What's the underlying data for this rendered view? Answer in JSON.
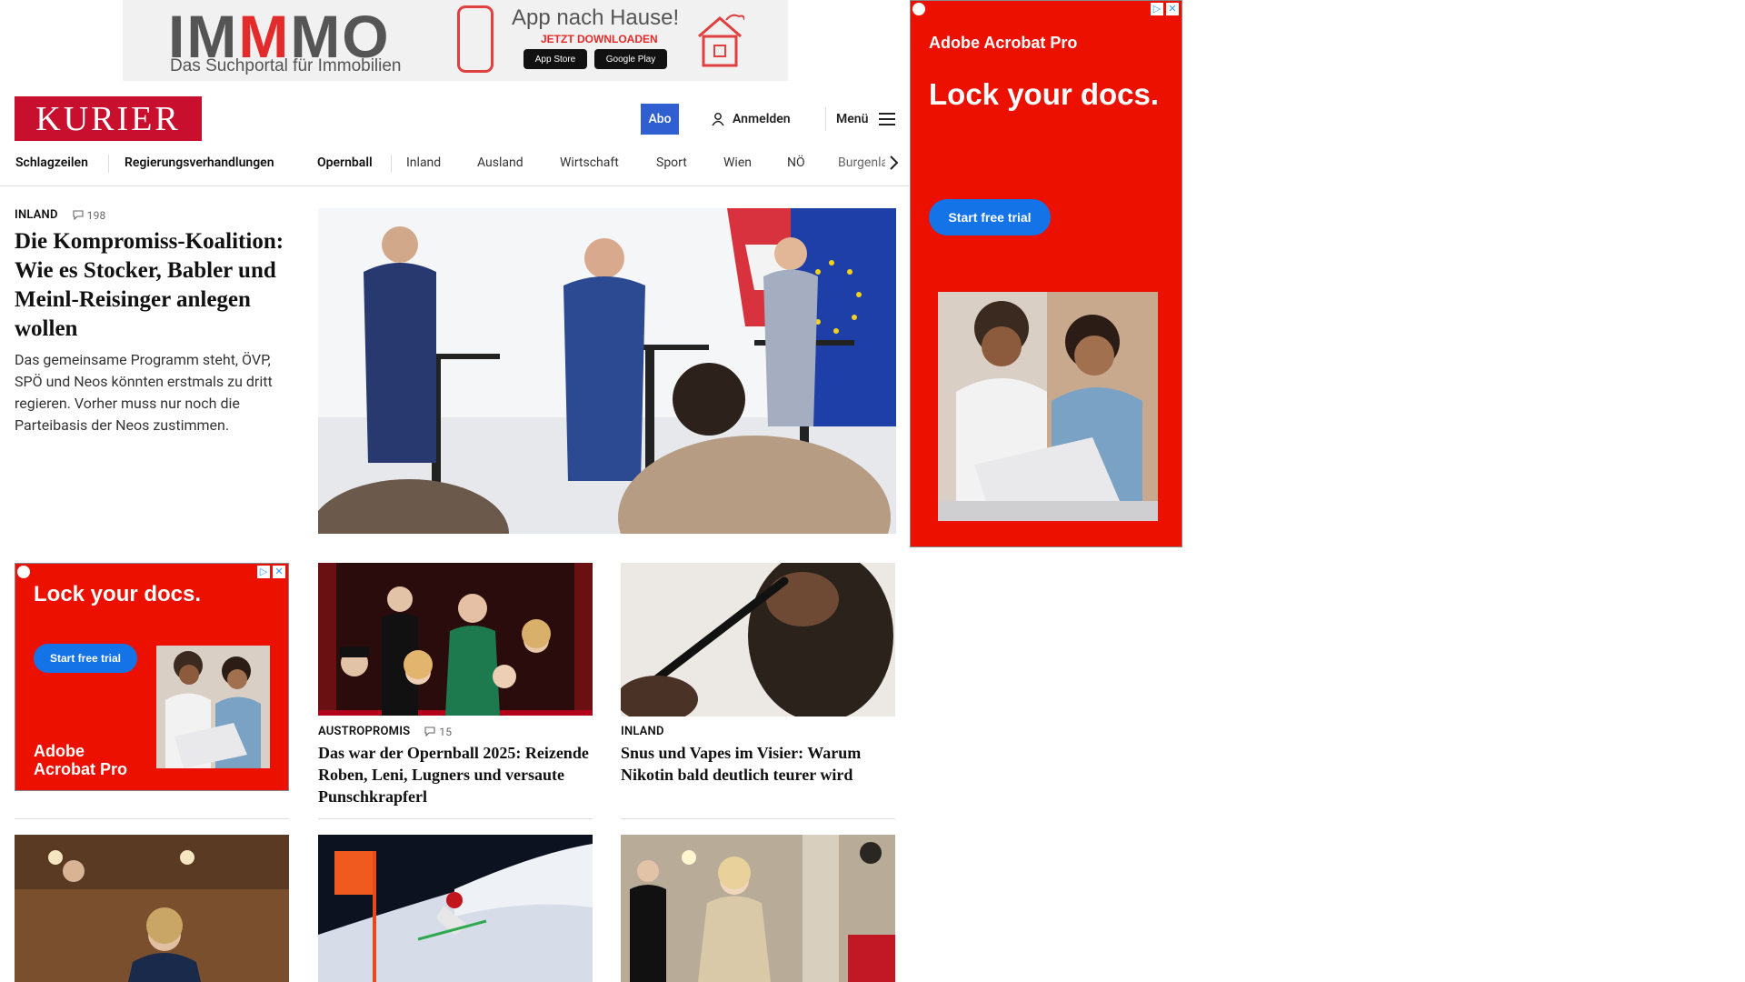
{
  "top_ad": {
    "logo_parts": [
      "IM",
      "M",
      "MO"
    ],
    "tagline": "Das Suchportal für Immobilien",
    "title": "App nach Hause!",
    "subtitle": "JETZT DOWNLOADEN",
    "store_buttons": [
      "App Store",
      "Google Play"
    ]
  },
  "header": {
    "logo": "KURIER",
    "abo": "Abo",
    "login": "Anmelden",
    "menu": "Menü"
  },
  "nav": {
    "items": [
      "Schlagzeilen",
      "Regierungsverhandlungen",
      "Opernball",
      "Inland",
      "Ausland",
      "Wirtschaft",
      "Sport",
      "Wien",
      "NÖ",
      "Burgenla"
    ]
  },
  "lead": {
    "category": "INLAND",
    "comments": "198",
    "title": "Die Kompromiss-Koalition: Wie es Stocker, Babler und Meinl-Reisinger anlegen wollen",
    "teaser": "Das gemeinsame Programm steht, ÖVP, SPÖ und Neos könnten erstmals zu dritt regieren. Vorher muss nur noch die Parteibasis der Neos zustimmen."
  },
  "side_ad": {
    "brand": "Adobe Acrobat Pro",
    "headline": "Lock your docs.",
    "cta": "Start free trial"
  },
  "small_ad": {
    "headline": "Lock your docs.",
    "cta": "Start free trial",
    "brand": "Adobe Acrobat Pro"
  },
  "teasers": [
    {
      "category": "AUSTROPROMIS",
      "comments": "15",
      "title": "Das war der Opernball 2025: Reizende Roben, Leni, Lugners und versaute Punschkrapferl"
    },
    {
      "category": "INLAND",
      "comments": "",
      "title": "Snus und Vapes im Visier: Warum Nikotin bald deutlich teurer wird"
    }
  ],
  "colors": {
    "brand_red": "#c8102e",
    "abo_blue": "#2f5fd0",
    "ad_red": "#eb1000",
    "ad_cta_blue": "#1473e6"
  }
}
